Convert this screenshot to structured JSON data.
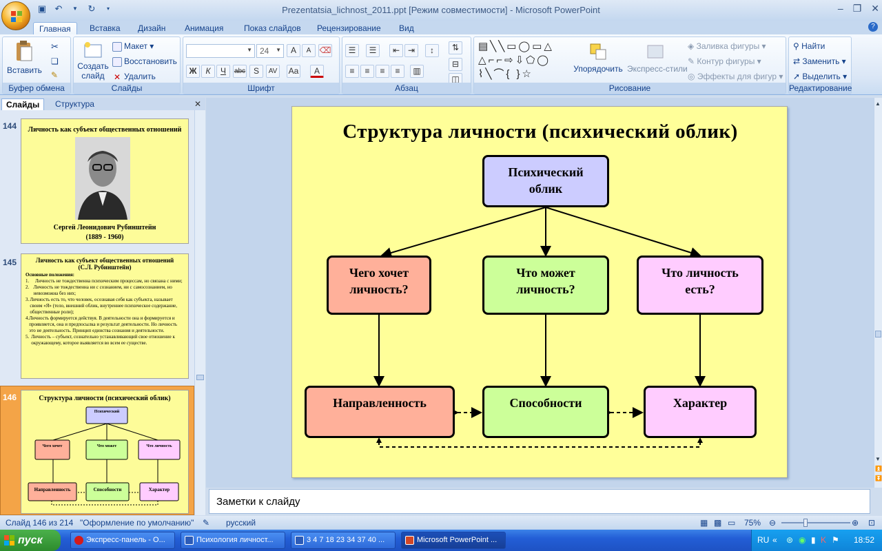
{
  "window": {
    "title": "Prezentatsia_lichnost_2011.ppt [Режим совместимости] - Microsoft PowerPoint"
  },
  "ribbon": {
    "tabs": [
      "Главная",
      "Вставка",
      "Дизайн",
      "Анимация",
      "Показ слайдов",
      "Рецензирование",
      "Вид"
    ],
    "clipboard": {
      "paste": "Вставить",
      "label": "Буфер обмена"
    },
    "slides": {
      "new_slide_1": "Создать",
      "new_slide_2": "слайд",
      "layout": "Макет",
      "reset": "Восстановить",
      "delete": "Удалить",
      "label": "Слайды"
    },
    "font": {
      "size": "24",
      "label": "Шрифт"
    },
    "paragraph": {
      "label": "Абзац"
    },
    "drawing": {
      "arrange": "Упорядочить",
      "quick_styles": "Экспресс-стили",
      "fill": "Заливка фигуры",
      "outline": "Контур фигуры",
      "effects": "Эффекты для фигур",
      "label": "Рисование"
    },
    "editing": {
      "find": "Найти",
      "replace": "Заменить",
      "select": "Выделить",
      "label": "Редактирование"
    }
  },
  "panel": {
    "tabs": [
      "Слайды",
      "Структура"
    ],
    "thumbs": [
      {
        "num": "144",
        "title": "Личность как субъект общественных отношений",
        "caption_1": "Сергей Леонидович Рубинштейн",
        "caption_2": "(1889 - 1960)"
      },
      {
        "num": "145",
        "title_1": "Личность как субъект общественных отношений",
        "title_2": "(С.Л. Рубинштейн)",
        "heading": "Основные положения:",
        "items": [
          "Личность не тождественна психическим процессам, но связана с ними;",
          "Личность не тождественна ни с сознанием, ни с самосознанием, но невозможна без них;",
          "Личность есть то, что человек, осознавая себя как субъекта, называет своим «Я» (тело, внешний облик, внутреннее психическое содержание, общественные роли);",
          "Личность формируется действуя. В деятельности она и формируется и проявляется, она и предпосылка и результат деятельности. Но личность это не деятельность. Принцип единства сознания и деятельности.",
          "Личность – субъект, сознательно устанавливающий свое отношение к окружающему, которое выявляется во всем ее существе."
        ]
      },
      {
        "num": "146",
        "title": "Структура личности (психический облик)"
      }
    ]
  },
  "slide": {
    "title": "Структура личности (психический облик)",
    "root": {
      "line1": "Психический",
      "line2": "облик",
      "color": "#ccccff"
    },
    "mid": [
      {
        "line1": "Чего хочет",
        "line2": "личность?",
        "color": "#ffb09a"
      },
      {
        "line1": "Что может",
        "line2": "личность?",
        "color": "#ccff99"
      },
      {
        "line1": "Что личность",
        "line2": "есть?",
        "color": "#ffccff"
      }
    ],
    "bottom": [
      {
        "label": "Направленность",
        "color": "#ffb09a"
      },
      {
        "label": "Способности",
        "color": "#ccff99"
      },
      {
        "label": "Характер",
        "color": "#ffccff"
      }
    ]
  },
  "notes": {
    "placeholder": "Заметки к слайду"
  },
  "status": {
    "slide_pos": "Слайд 146 из 214",
    "theme": "\"Оформление по умолчанию\"",
    "lang": "русский",
    "zoom": "75%"
  },
  "taskbar": {
    "start": "пуск",
    "tasks": [
      "Экспресс-панель - О...",
      "Психология личност...",
      "3 4 7 18 23 34 37 40 ...",
      "Microsoft PowerPoint ..."
    ],
    "lang": "RU",
    "clock": "18:52"
  }
}
